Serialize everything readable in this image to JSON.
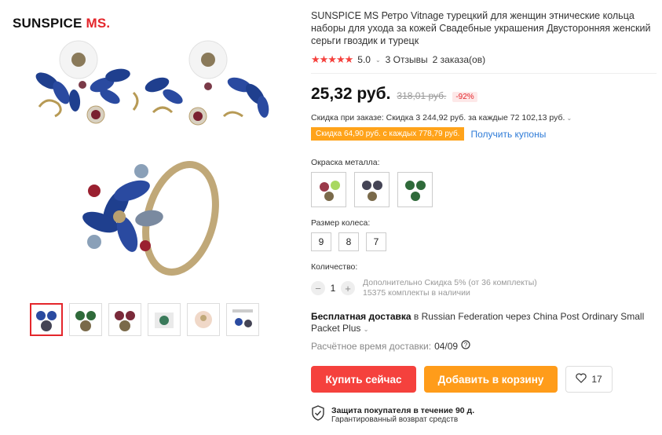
{
  "brand": {
    "main": "SUNSPICE",
    "suffix": "MS."
  },
  "product": {
    "title": "SUNSPICE MS Ретро Vitnage турецкий для женщин этнические кольца наборы для ухода за кожей Свадебные украшения Двусторонняя женский серьги гвоздик и турецк",
    "stars": "★★★★★",
    "rating": "5.0",
    "reviews": "3 Отзывы",
    "orders": "2 заказа(ов)",
    "price": "25,32 руб.",
    "old_price": "318,01 руб.",
    "discount": "-92%",
    "order_discount": "Скидка при заказе: Скидка 3 244,92 руб. за каждые 72 102,13 руб.",
    "coupon_tag": "Скидка 64,90 руб. с каждых 778,79 руб.",
    "coupon_link": "Получить купоны",
    "metal_label": "Окраска металла:",
    "size_label": "Размер колеса:",
    "sizes": [
      "9",
      "8",
      "7"
    ],
    "qty_label": "Количество:",
    "qty_value": "1",
    "qty_info_1": "Дополнительно Скидка 5% (от 36 комплекты)",
    "qty_info_2": "15375 комплекты в наличии",
    "delivery_bold": "Бесплатная доставка",
    "delivery_rest": "в Russian Federation через China Post Ordinary Small Packet Plus",
    "est_label": "Расчётное время доставки:",
    "est_value": "04/09",
    "buy_label": "Купить сейчас",
    "cart_label": "Добавить в корзину",
    "wish_count": "17",
    "protect_title": "Защита покупателя в течение 90 д.",
    "protect_sub": "Гарантированный возврат средств"
  },
  "colors": {
    "accent": "#f5413d",
    "orange": "#ff9c1a",
    "link": "#2e7bd7"
  },
  "icons": [
    "star-icon",
    "chevron-down-icon",
    "heart-icon",
    "shield-check-icon",
    "question-icon",
    "minus-icon",
    "plus-icon"
  ]
}
